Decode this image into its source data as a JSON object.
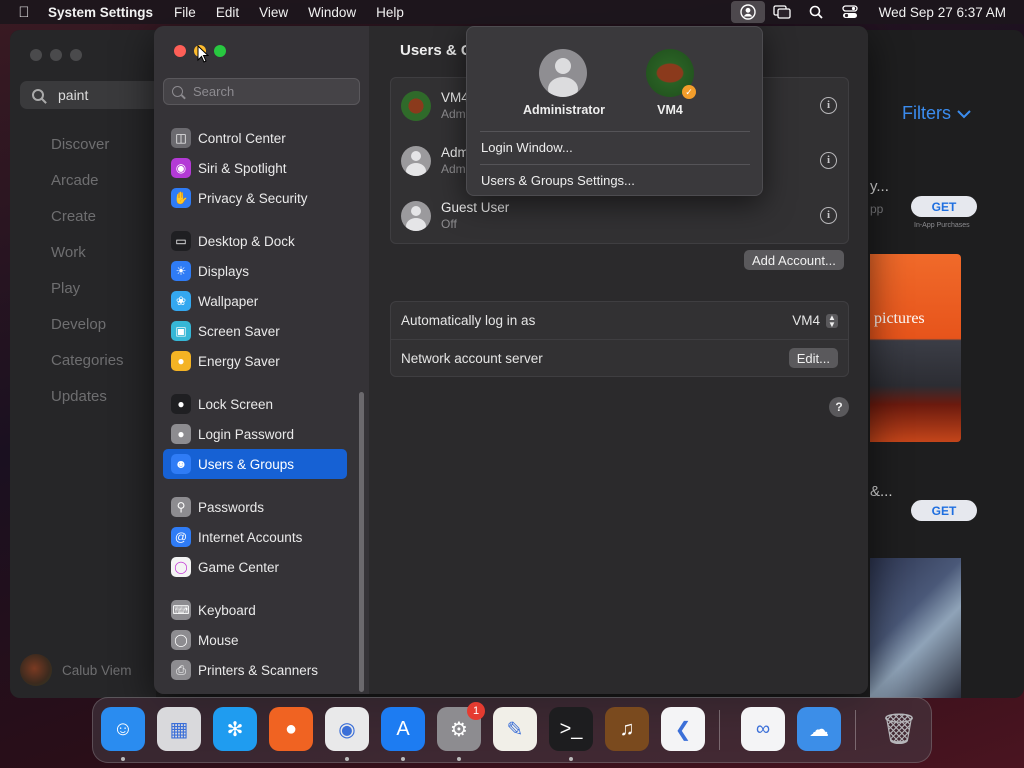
{
  "menubar": {
    "app_name": "System Settings",
    "menus": [
      "File",
      "Edit",
      "View",
      "Window",
      "Help"
    ],
    "clock": "Wed Sep 27  6:37 AM"
  },
  "store": {
    "search_value": "paint",
    "nav": [
      "Discover",
      "Arcade",
      "Create",
      "Work",
      "Play",
      "Develop",
      "Categories",
      "Updates"
    ],
    "user_name": "Calub Viem",
    "filters_label": "Filters",
    "item1_title": "y...",
    "item1_sub": "pp",
    "get_label": "GET",
    "in_app": "In-App Purchases",
    "promo_text": "pictures",
    "item2_title": "&..."
  },
  "settings": {
    "search_placeholder": "Search",
    "sidebar": [
      {
        "label": "Control Center",
        "icon": "control-center-icon",
        "color": "#6b6a6f"
      },
      {
        "label": "Siri & Spotlight",
        "icon": "siri-icon",
        "color": "#b43ad6"
      },
      {
        "label": "Privacy & Security",
        "icon": "hand-icon",
        "color": "#2f7cf6"
      },
      {
        "label": "Desktop & Dock",
        "icon": "dock-icon",
        "color": "#1f1f22"
      },
      {
        "label": "Displays",
        "icon": "sun-icon",
        "color": "#2f7cf6"
      },
      {
        "label": "Wallpaper",
        "icon": "flower-icon",
        "color": "#34a8f0"
      },
      {
        "label": "Screen Saver",
        "icon": "screen-saver-icon",
        "color": "#36b7d6"
      },
      {
        "label": "Energy Saver",
        "icon": "bulb-icon",
        "color": "#f4b324"
      },
      {
        "label": "Lock Screen",
        "icon": "lock-icon",
        "color": "#1f1f22"
      },
      {
        "label": "Login Password",
        "icon": "padlock-icon",
        "color": "#8d8c90"
      },
      {
        "label": "Users & Groups",
        "icon": "users-icon",
        "color": "#2f7cf6"
      },
      {
        "label": "Passwords",
        "icon": "key-icon",
        "color": "#8d8c90"
      },
      {
        "label": "Internet Accounts",
        "icon": "at-icon",
        "color": "#2f7cf6"
      },
      {
        "label": "Game Center",
        "icon": "game-center-icon",
        "color": "#f4f4f4"
      },
      {
        "label": "Keyboard",
        "icon": "keyboard-icon",
        "color": "#8d8c90"
      },
      {
        "label": "Mouse",
        "icon": "mouse-icon",
        "color": "#8d8c90"
      },
      {
        "label": "Printers & Scanners",
        "icon": "printer-icon",
        "color": "#8d8c90"
      }
    ],
    "main_title": "Users & G",
    "users": [
      {
        "name": "VM4",
        "role": "Adm"
      },
      {
        "name": "Adm",
        "role": "Adm"
      },
      {
        "name": "Guest User",
        "role": "Off"
      }
    ],
    "add_account_label": "Add Account...",
    "options": {
      "autologin_label": "Automatically log in as",
      "autologin_value": "VM4",
      "network_label": "Network account server",
      "edit_label": "Edit..."
    },
    "help_label": "?"
  },
  "popover": {
    "users": [
      "Administrator",
      "VM4"
    ],
    "items": [
      "Login Window...",
      "Users & Groups Settings..."
    ]
  },
  "dock": {
    "apps": [
      {
        "name": "finder-icon",
        "color": "#2a8cf0"
      },
      {
        "name": "launchpad-icon",
        "color": "#d9d9dc"
      },
      {
        "name": "safari-icon",
        "color": "#1f9cf0"
      },
      {
        "name": "firefox-icon",
        "color": "#f06322"
      },
      {
        "name": "chrome-icon",
        "color": "#e9e9ea"
      },
      {
        "name": "app-store-icon",
        "color": "#1d7cf2"
      },
      {
        "name": "system-settings-icon",
        "color": "#8d8c90"
      },
      {
        "name": "textedit-icon",
        "color": "#f1efe8"
      },
      {
        "name": "terminal-icon",
        "color": "#1d1d1f"
      },
      {
        "name": "garageband-icon",
        "color": "#7a4a1e"
      },
      {
        "name": "vscode-icon",
        "color": "#f4f4f6"
      },
      {
        "name": "visual-studio-icon",
        "color": "#f4f4f6"
      },
      {
        "name": "weather-icon",
        "color": "#3c8ee8"
      },
      {
        "name": "trash-icon",
        "color": "#8e8e92"
      }
    ],
    "settings_badge": "1"
  }
}
